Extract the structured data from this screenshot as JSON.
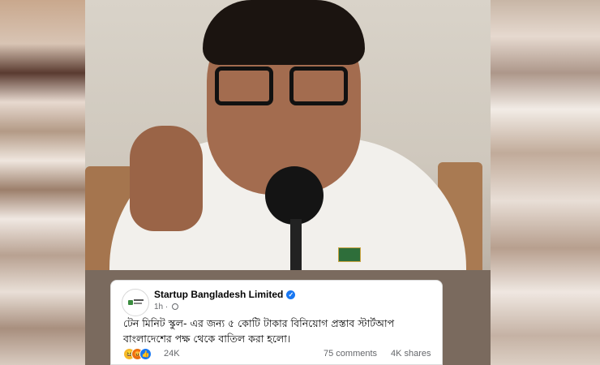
{
  "post": {
    "page_name": "Startup Bangladesh Limited",
    "time": "1h",
    "text": "টেন মিনিট স্কুল- এর জন্য ৫ কোটি টাকার বিনিয়োগ প্রস্তাব স্টার্টআপ বাংলাদেশের পক্ষ থেকে বাতিল করা হলো।",
    "reaction_count": "24K",
    "comments": "75 comments",
    "shares": "4K shares"
  },
  "icons": {
    "verified": "verified-badge-icon",
    "privacy": "globe-icon",
    "reactions": [
      "haha-reaction-icon",
      "angry-reaction-icon",
      "like-reaction-icon"
    ]
  },
  "colors": {
    "verified": "#1877f2",
    "like": "#1877f2",
    "haha": "#f7b928",
    "angry": "#e9710f"
  }
}
